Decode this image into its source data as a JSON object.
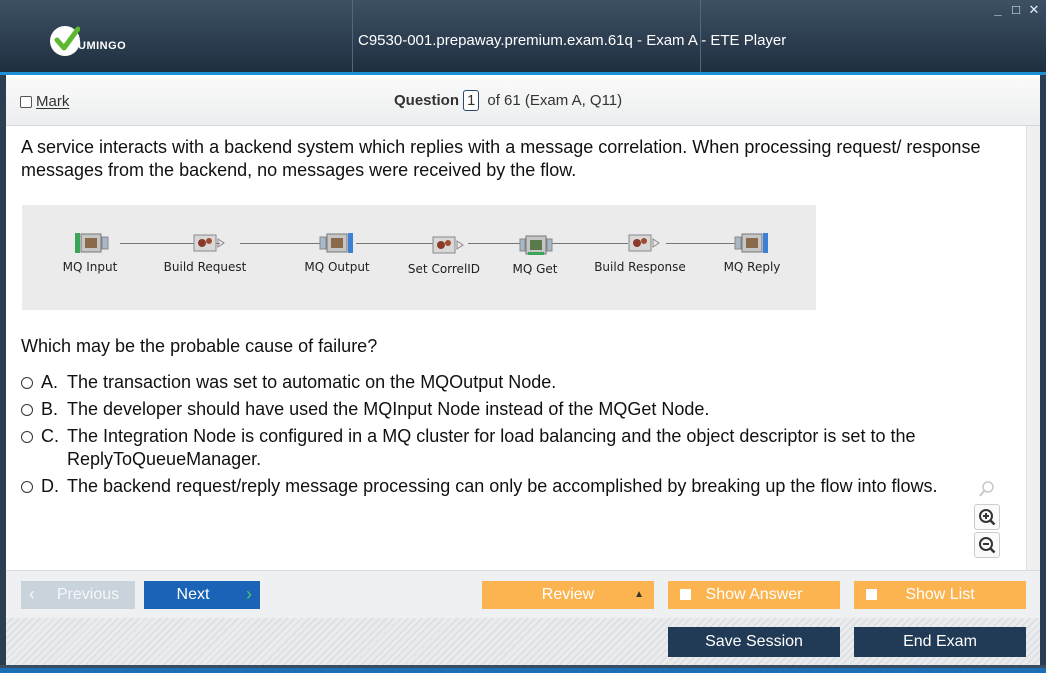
{
  "window": {
    "title": "C9530-001.prepaway.premium.exam.61q - Exam A - ETE Player",
    "logo_text": "UMINGO",
    "controls": [
      "_",
      "□",
      "✕"
    ]
  },
  "header": {
    "mark_label": "Mark",
    "question_label": "Question",
    "question_number": "1",
    "question_of": "of 61 (Exam A, Q11)"
  },
  "question": {
    "stem": "A service interacts with a backend system which replies with a message correlation. When processing request/ response messages from the backend, no messages were received by the flow.",
    "exhibit_nodes": [
      "MQ Input",
      "Build Request",
      "MQ Output",
      "Set CorrelID",
      "MQ Get",
      "Build Response",
      "MQ Reply"
    ],
    "prompt": "Which may be the probable cause of failure?",
    "options": [
      {
        "letter": "A.",
        "text": "The transaction was set to automatic on the MQOutput Node."
      },
      {
        "letter": "B.",
        "text": "The developer should have used the MQInput Node instead of the MQGet Node."
      },
      {
        "letter": "C.",
        "text": "The Integration Node is configured in a MQ cluster for load balancing and the object descriptor is set to the ReplyToQueueManager."
      },
      {
        "letter": "D.",
        "text": "The backend request/reply message processing can only be accomplished by breaking up the flow into flows."
      }
    ]
  },
  "nav": {
    "previous": "Previous",
    "next": "Next",
    "review": "Review",
    "show_answer": "Show Answer",
    "show_list": "Show List",
    "save_session": "Save Session",
    "end_exam": "End Exam"
  },
  "colors": {
    "title_bg": "#2b3e52",
    "accent_blue": "#1a63b6",
    "orange": "#fbb44f",
    "dark_button": "#213a55"
  }
}
